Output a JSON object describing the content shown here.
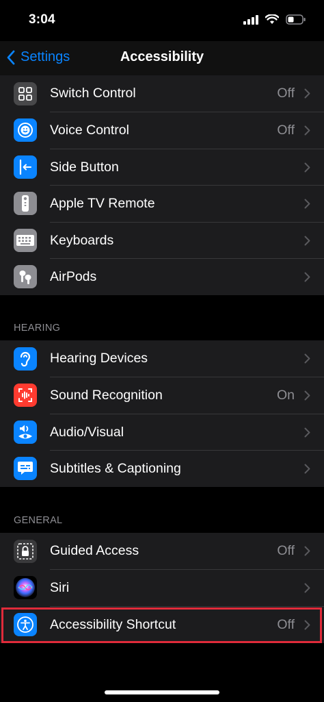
{
  "status": {
    "time": "3:04"
  },
  "nav": {
    "back_label": "Settings",
    "title": "Accessibility"
  },
  "groups": {
    "interaction": [
      {
        "label": "Switch Control",
        "value": "Off",
        "icon": "switch-control-icon",
        "color": "#636366"
      },
      {
        "label": "Voice Control",
        "value": "Off",
        "icon": "voice-control-icon",
        "color": "#0a84ff"
      },
      {
        "label": "Side Button",
        "value": "",
        "icon": "side-button-icon",
        "color": "#0a84ff"
      },
      {
        "label": "Apple TV Remote",
        "value": "",
        "icon": "tv-remote-icon",
        "color": "#8e8e93"
      },
      {
        "label": "Keyboards",
        "value": "",
        "icon": "keyboard-icon",
        "color": "#8e8e93"
      },
      {
        "label": "AirPods",
        "value": "",
        "icon": "airpods-icon",
        "color": "#8e8e93"
      }
    ],
    "hearing": {
      "header": "HEARING",
      "items": [
        {
          "label": "Hearing Devices",
          "value": "",
          "icon": "ear-icon",
          "color": "#0a84ff"
        },
        {
          "label": "Sound Recognition",
          "value": "On",
          "icon": "sound-recognition-icon",
          "color": "#ff3b30"
        },
        {
          "label": "Audio/Visual",
          "value": "",
          "icon": "audio-visual-icon",
          "color": "#0a84ff"
        },
        {
          "label": "Subtitles & Captioning",
          "value": "",
          "icon": "subtitles-icon",
          "color": "#0a84ff"
        }
      ]
    },
    "general": {
      "header": "GENERAL",
      "items": [
        {
          "label": "Guided Access",
          "value": "Off",
          "icon": "lock-icon",
          "color": "#3a3a3c"
        },
        {
          "label": "Siri",
          "value": "",
          "icon": "siri-icon",
          "color": "#000000"
        },
        {
          "label": "Accessibility Shortcut",
          "value": "Off",
          "icon": "accessibility-icon",
          "color": "#0a84ff"
        }
      ]
    }
  }
}
